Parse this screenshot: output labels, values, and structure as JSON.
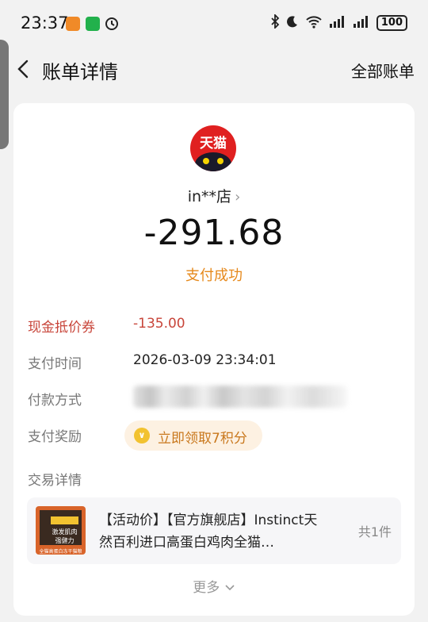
{
  "status_bar": {
    "time": "23:37",
    "battery": "100",
    "icons": [
      "taobao-icon",
      "wechat-icon",
      "alarm-icon",
      "bluetooth-icon",
      "moon-icon",
      "wifi-icon",
      "signal-icon"
    ]
  },
  "header": {
    "title": "账单详情",
    "right_link": "全部账单"
  },
  "merchant": {
    "logo_text": "天猫",
    "name": "in**店",
    "amount": "-291.68",
    "status": "支付成功"
  },
  "details": {
    "coupon": {
      "label": "现金抵价券",
      "value": "-135.00"
    },
    "pay_time": {
      "label": "支付时间",
      "value": "2026-03-09 23:34:01"
    },
    "pay_method": {
      "label": "付款方式"
    },
    "reward": {
      "label": "支付奖励",
      "value": "立即领取7积分"
    },
    "trade_section": {
      "label": "交易详情"
    }
  },
  "product": {
    "title": "【活动价】【官方旗舰店】Instinct天然百利进口高蛋白鸡肉全猫…",
    "count": "共1件",
    "image_text_1": "激发肌肉",
    "image_text_2": "强健力",
    "image_text_3": "全猫高蛋白冻干猫粮4.5kg"
  },
  "more_label": "更多",
  "colors": {
    "accent_orange": "#e6891c",
    "coupon_red": "#c8453a",
    "tmall_red": "#e02020"
  }
}
